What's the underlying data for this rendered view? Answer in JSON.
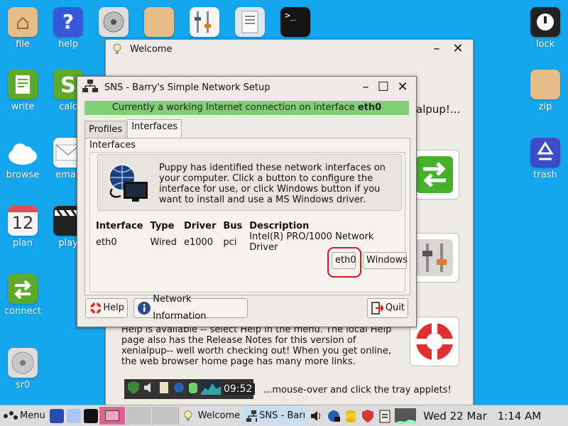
{
  "desktop": {
    "left_icons": [
      {
        "label": "file",
        "icon": "home-folder-icon"
      },
      {
        "label": "help",
        "icon": "help-icon"
      },
      {
        "label": "write",
        "icon": "write-icon"
      },
      {
        "label": "calc",
        "icon": "calc-icon"
      },
      {
        "label": "browse",
        "icon": "cloud-icon"
      },
      {
        "label": "email",
        "icon": "envelope-icon"
      },
      {
        "label": "plan",
        "icon": "calendar-icon"
      },
      {
        "label": "play",
        "icon": "clapper-icon"
      },
      {
        "label": "connect",
        "icon": "connect-arrows-icon"
      },
      {
        "label": "sr0",
        "icon": "disc-icon"
      }
    ],
    "plan_date": "12",
    "right_icons": [
      {
        "label": "lock",
        "icon": "lock-icon"
      },
      {
        "label": "zip",
        "icon": "zip-folder-icon"
      },
      {
        "label": "trash",
        "icon": "recycle-icon"
      }
    ],
    "partial_label": "n"
  },
  "welcome": {
    "title": "Welcome",
    "partial_heading": "alpup!...",
    "text_lines": [
      "Help is available -- select Help in the menu. The local Help",
      "page also has the Release Notes for this version of",
      "xenialpup-- well worth checking out! When you get online,",
      "the web browser home page has many more links."
    ],
    "tray_time": "09:52",
    "tray_hint": "...mouse-over and click the tray applets!"
  },
  "sns": {
    "title": "SNS - Barry's Simple Network Setup",
    "status_prefix": "Currently a working Internet connection on interface",
    "status_iface": "eth0",
    "tabs": [
      {
        "label": "Profiles",
        "active": false
      },
      {
        "label": "Interfaces",
        "active": true
      }
    ],
    "frame_label": "Interfaces",
    "info_text": "Puppy has identified these network interfaces on your computer. Click a button to configure the interface for use, or click Windows button if you want to install and use a MS Windows driver.",
    "table": {
      "headers": [
        "Interface",
        "Type",
        "Driver",
        "Bus",
        "Description"
      ],
      "rows": [
        [
          "eth0",
          "Wired",
          "e1000",
          "pci",
          "Intel(R) PRO/1000 Network Driver"
        ]
      ]
    },
    "eth0_button": "eth0",
    "windows_button": "Windows",
    "help_button": "Help",
    "netinfo_button": "Network Information",
    "quit_button": "Quit"
  },
  "taskbar": {
    "menu_label": "Menu",
    "tasks": [
      {
        "label": "Welcome",
        "icon": "bulb-icon"
      },
      {
        "label": "SNS - Barı",
        "icon": "network-icon"
      }
    ],
    "clock_date": "Wed 22 Mar",
    "clock_time": "1:14 AM"
  },
  "colors": {
    "desktop": "#15a6ee",
    "status_green": "#80cf74",
    "highlight_ring": "#e0121e"
  }
}
